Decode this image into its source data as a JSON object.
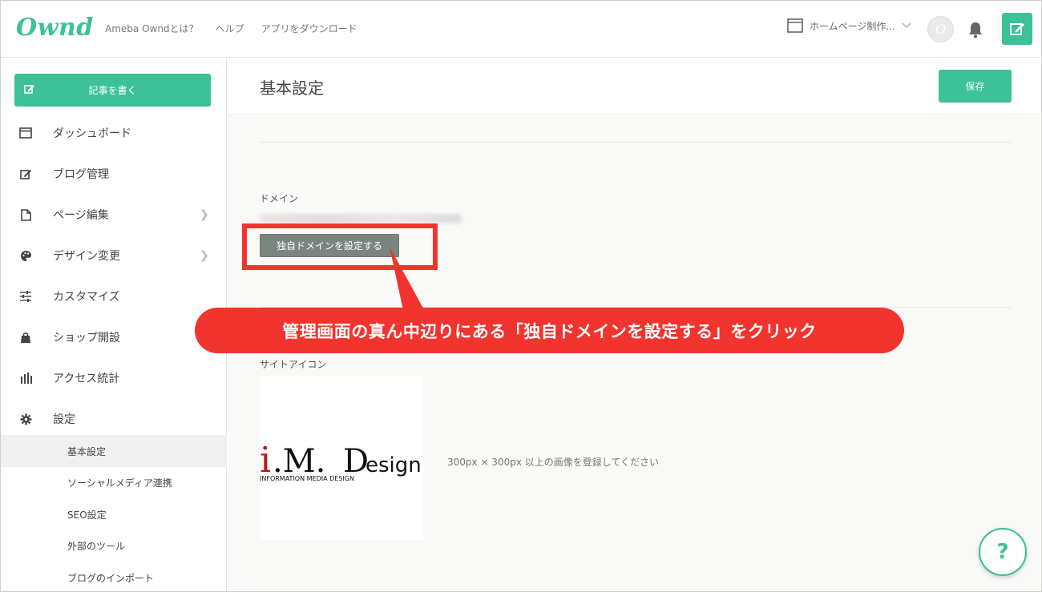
{
  "header": {
    "logo": "Ownd",
    "nav": [
      "Ameba Owndとは？",
      "ヘルプ",
      "アプリをダウンロード"
    ],
    "site_name": "ホームページ制作...",
    "avatar_letter": "O"
  },
  "sidebar": {
    "write_label": "記事を書く",
    "items": [
      {
        "label": "ダッシュボード",
        "icon": "dashboard-icon"
      },
      {
        "label": "ブログ管理",
        "icon": "edit-icon"
      },
      {
        "label": "ページ編集",
        "icon": "page-icon",
        "chevron": true
      },
      {
        "label": "デザイン変更",
        "icon": "palette-icon",
        "chevron": true
      },
      {
        "label": "カスタマイズ",
        "icon": "sliders-icon"
      },
      {
        "label": "ショップ開設",
        "icon": "shop-bag-icon"
      },
      {
        "label": "アクセス統計",
        "icon": "bar-chart-icon"
      },
      {
        "label": "設定",
        "icon": "gear-icon"
      }
    ],
    "sub_items": [
      {
        "label": "基本設定",
        "active": true
      },
      {
        "label": "ソーシャルメディア連携"
      },
      {
        "label": "SEO設定"
      },
      {
        "label": "外部のツール"
      },
      {
        "label": "ブログのインポート"
      }
    ]
  },
  "main": {
    "page_title": "基本設定",
    "save_label": "保存",
    "domain_label": "ドメイン",
    "custom_domain_button": "独自ドメインを設定する",
    "site_icon_label": "サイトアイコン",
    "icon_logo_main": "i.M.Design",
    "icon_logo_sub": "INFORMATION MEDIA DESIGN",
    "icon_hint": "300px × 300px 以上の画像を登録してください"
  },
  "annotation": {
    "callout": "管理画面の真ん中辺りにある「独自ドメインを設定する」をクリック",
    "color": "#f2342e"
  },
  "help_label": "?",
  "colors": {
    "accent": "#3cc198",
    "annotation": "#f2342e"
  }
}
